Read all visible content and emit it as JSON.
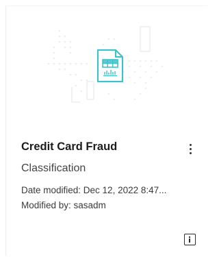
{
  "card": {
    "title": "Credit Card Fraud",
    "subtitle": "Classification",
    "date_modified": "Date modified: Dec 12, 2022 8:47...",
    "modified_by": "Modified by: sasadm",
    "thumbnail_icon": "spreadsheet-chart-icon",
    "menu_icon": "kebab-menu-icon",
    "info_icon": "info-icon",
    "accent_color": "#3fc1c9"
  }
}
